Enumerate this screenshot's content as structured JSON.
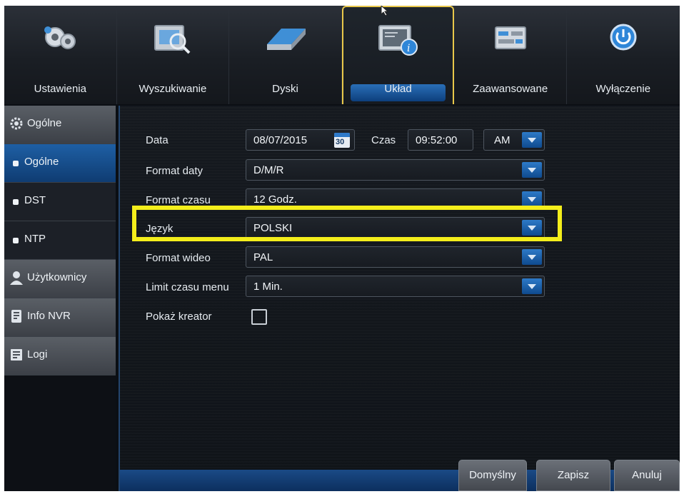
{
  "top_tabs": [
    {
      "label": "Ustawienia"
    },
    {
      "label": "Wyszukiwanie"
    },
    {
      "label": "Dyski"
    },
    {
      "label": "Układ"
    },
    {
      "label": "Zaawansowane"
    },
    {
      "label": "Wyłączenie"
    }
  ],
  "active_tab": "Układ",
  "sidebar": {
    "items": [
      {
        "label": "Ogólne",
        "type": "category",
        "icon": "gear-icon"
      },
      {
        "label": "Ogólne",
        "type": "sub",
        "active": true
      },
      {
        "label": "DST",
        "type": "sub"
      },
      {
        "label": "NTP",
        "type": "sub"
      },
      {
        "label": "Użytkownicy",
        "type": "category",
        "icon": "user-icon"
      },
      {
        "label": "Info NVR",
        "type": "category",
        "icon": "info-device-icon"
      },
      {
        "label": "Logi",
        "type": "category",
        "icon": "log-icon"
      }
    ]
  },
  "form": {
    "date_label": "Data",
    "date_value": "08/07/2015",
    "calendar_day": "30",
    "time_label": "Czas",
    "time_value": "09:52:00",
    "ampm_value": "AM",
    "date_format_label": "Format daty",
    "date_format_value": "D/M/R",
    "time_format_label": "Format czasu",
    "time_format_value": "12 Godz.",
    "language_label": "Język",
    "language_value": "POLSKI",
    "video_format_label": "Format wideo",
    "video_format_value": "PAL",
    "menu_timeout_label": "Limit czasu menu",
    "menu_timeout_value": "1 Min.",
    "wizard_label": "Pokaż kreator",
    "wizard_checked": false
  },
  "buttons": {
    "default_label": "Domyślny",
    "save_label": "Zapisz",
    "cancel_label": "Anuluj"
  },
  "colors": {
    "accent_blue": "#1e5fa4",
    "highlight_yellow": "#f4ee1b",
    "active_tab_border": "#e9c84a"
  }
}
